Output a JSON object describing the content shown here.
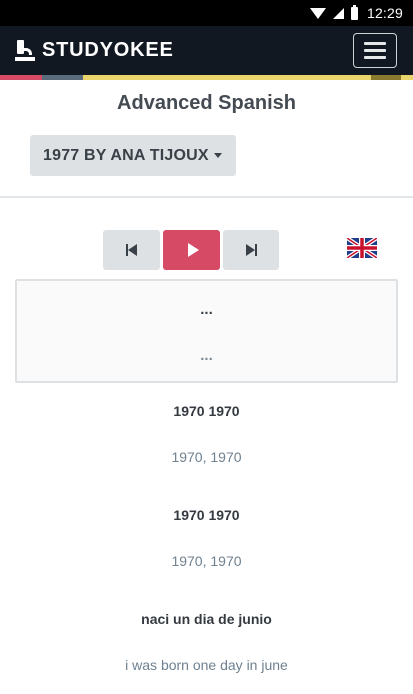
{
  "status_bar": {
    "time": "12:29"
  },
  "header": {
    "brand": "STUDYOKEE",
    "menu_label": ""
  },
  "stripe": {
    "colors": [
      "#d74a66",
      "#5a6b7b",
      "#e9d56c",
      "#e9d56c",
      "#8a7a2e"
    ]
  },
  "course": {
    "title": "Advanced Spanish"
  },
  "song_selector": {
    "label": "1977 BY ANA TIJOUX"
  },
  "player": {
    "prev_icon": "skip-previous-icon",
    "play_icon": "play-icon",
    "next_icon": "skip-next-icon",
    "language_flag": "uk-flag-icon"
  },
  "current_lyric": {
    "original": "...",
    "translation": "..."
  },
  "lyrics": [
    {
      "original": "1970 1970",
      "translation": "1970, 1970"
    },
    {
      "original": "1970 1970",
      "translation": "1970, 1970"
    },
    {
      "original": "naci un dia de junio",
      "translation": "i was born one day in june"
    }
  ]
}
